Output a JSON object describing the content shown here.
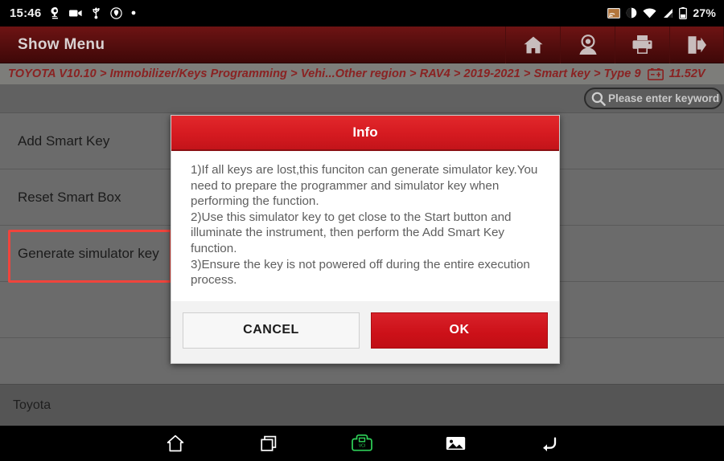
{
  "statusbar": {
    "time": "15:46",
    "left_icons": [
      "location-icon",
      "camera-icon",
      "usb-icon",
      "do-not-disturb-icon",
      "dot-icon"
    ],
    "right_icons": [
      "screencast-icon",
      "brightness-icon",
      "wifi-icon",
      "signal-icon",
      "battery-icon"
    ],
    "battery_percent": "27%"
  },
  "appbar": {
    "title": "Show Menu",
    "actions": [
      {
        "name": "home-icon",
        "label": "Home"
      },
      {
        "name": "account-icon",
        "label": "Account"
      },
      {
        "name": "print-icon",
        "label": "Print"
      },
      {
        "name": "exit-icon",
        "label": "Exit"
      }
    ]
  },
  "breadcrumb": {
    "path": "TOYOTA V10.10 > Immobilizer/Keys Programming > Vehi...Other region > RAV4 > 2019-2021 > Smart key > Type 9",
    "battery_icon": "car-battery-icon",
    "voltage": "11.52V"
  },
  "search": {
    "icon": "search-icon",
    "placeholder": "Please enter keyword"
  },
  "menu": {
    "items": [
      {
        "label": "Add Smart Key",
        "highlighted": false
      },
      {
        "label": "Reset Smart Box",
        "highlighted": false
      },
      {
        "label": "Generate simulator key",
        "highlighted": true
      },
      {
        "label": "",
        "highlighted": false
      }
    ]
  },
  "brandbar": {
    "label": "Toyota"
  },
  "dialog": {
    "title": "Info",
    "lines": [
      "1)If all keys are lost,this funciton can generate simulator key.You need to prepare the programmer and simulator key when performing the function.",
      "2)Use this simulator key to get close to the Start button and illuminate the instrument, then perform the Add Smart Key function.",
      "3)Ensure the key is not powered off during the entire execution process."
    ],
    "cancel_label": "CANCEL",
    "ok_label": "OK"
  },
  "navbar": {
    "buttons": [
      {
        "name": "nav-home-icon",
        "label": "Home"
      },
      {
        "name": "nav-recents-icon",
        "label": "Recents"
      },
      {
        "name": "nav-vci-icon",
        "label": "VCI"
      },
      {
        "name": "nav-gallery-icon",
        "label": "Gallery"
      },
      {
        "name": "nav-back-icon",
        "label": "Back"
      }
    ]
  },
  "colors": {
    "brand_red": "#c3141a",
    "header_dark_red": "#5a0f0f",
    "highlight_red": "#f0443c",
    "panel_gray": "#6b6b6b",
    "vci_green": "#2fd45a"
  }
}
